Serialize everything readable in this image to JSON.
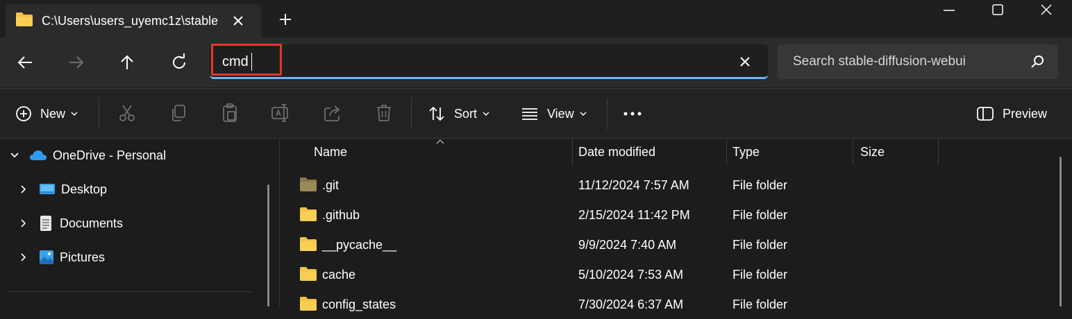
{
  "tab": {
    "title": "C:\\Users\\users_uyemc1z\\stable",
    "close_icon": "close-icon",
    "new_tab_icon": "plus-icon"
  },
  "window_controls": [
    "minimize-icon",
    "maximize-icon",
    "close-icon"
  ],
  "address_bar": {
    "value": "cmd",
    "search_placeholder": "Search stable-diffusion-webui"
  },
  "toolbar": {
    "new_label": "New",
    "sort_label": "Sort",
    "view_label": "View",
    "preview_label": "Preview",
    "icons": [
      "cut-icon",
      "copy-icon",
      "paste-icon",
      "rename-icon",
      "share-icon",
      "delete-icon"
    ]
  },
  "nav_pane": {
    "onedrive_label": "OneDrive - Personal",
    "items": [
      {
        "label": "Desktop",
        "icon": "desktop-icon"
      },
      {
        "label": "Documents",
        "icon": "documents-icon"
      },
      {
        "label": "Pictures",
        "icon": "pictures-icon"
      }
    ]
  },
  "file_list": {
    "columns": [
      "Name",
      "Date modified",
      "Type",
      "Size"
    ],
    "rows": [
      {
        "name": ".git",
        "date": "11/12/2024 7:57 AM",
        "type": "File folder",
        "icon": "folder-dim-icon"
      },
      {
        "name": ".github",
        "date": "2/15/2024 11:42 PM",
        "type": "File folder",
        "icon": "folder-icon"
      },
      {
        "name": "__pycache__",
        "date": "9/9/2024 7:40 AM",
        "type": "File folder",
        "icon": "folder-icon"
      },
      {
        "name": "cache",
        "date": "5/10/2024 7:53 AM",
        "type": "File folder",
        "icon": "folder-icon"
      },
      {
        "name": "config_states",
        "date": "7/30/2024 6:37 AM",
        "type": "File folder",
        "icon": "folder-icon"
      }
    ]
  },
  "colors": {
    "highlight_outline": "#e3372e",
    "address_accent": "#6cb6ff",
    "folder": "#f5c342"
  }
}
